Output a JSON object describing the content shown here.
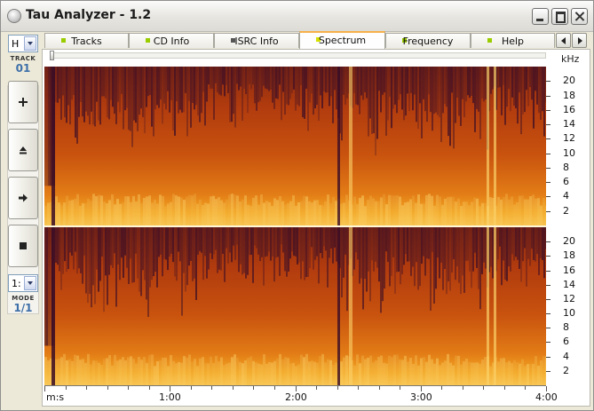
{
  "window": {
    "title": "Tau Analyzer - 1.2"
  },
  "left_panel": {
    "channel_select": "H",
    "track_label": "TRACK",
    "track_value": "01",
    "mode_select": "1:",
    "mode_label": "MODE",
    "mode_value": "1/1",
    "buttons": [
      "plus-icon",
      "eject-icon",
      "play-icon",
      "stop-icon"
    ]
  },
  "tabs": [
    {
      "label": "Tracks",
      "led_color": "#9acd00",
      "active": false
    },
    {
      "label": "CD Info",
      "led_color": "#9acd00",
      "active": false
    },
    {
      "label": "ISRC Info",
      "led_color": "#555555",
      "active": false
    },
    {
      "label": "Spectrum",
      "led_color": "#d6e000",
      "active": true
    },
    {
      "label": "Frequency",
      "led_color": "#9acd00",
      "active": false
    },
    {
      "label": "Help",
      "led_color": "#9acd00",
      "active": false
    }
  ],
  "spectrum": {
    "y_unit": "kHz",
    "y_ticks": [
      "20",
      "18",
      "16",
      "14",
      "12",
      "10",
      "8",
      "6",
      "4",
      "2"
    ],
    "x_ticks": [
      "m:s",
      "1:00",
      "2:00",
      "3:00",
      "4:00"
    ],
    "channels": 2,
    "colors": {
      "low": "#3a0d26",
      "mid": "#b3400c",
      "high": "#f0a020",
      "peak": "#fbd26a"
    }
  }
}
